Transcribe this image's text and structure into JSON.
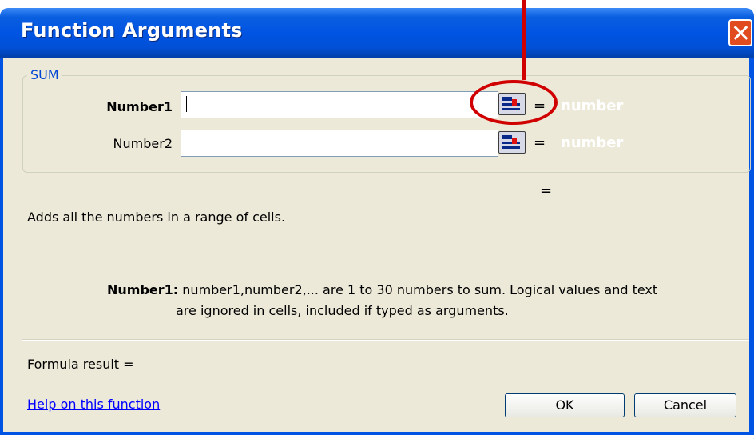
{
  "dialog": {
    "title": "Function Arguments",
    "group_label": "SUM",
    "arguments": [
      {
        "label": "Number1",
        "value": "",
        "equals": "=",
        "hint": "number"
      },
      {
        "label": "Number2",
        "value": "",
        "equals": "=",
        "hint": "number"
      }
    ],
    "result_equals": "=",
    "description": "Adds all the numbers in a range of cells.",
    "arg_help_name": "Number1:",
    "arg_help_line1": "number1,number2,... are 1 to 30 numbers to sum. Logical values and text",
    "arg_help_line2": "are ignored in cells, included if typed as arguments.",
    "formula_result_label": "Formula result =",
    "help_link": "Help on this function",
    "ok_label": "OK",
    "cancel_label": "Cancel"
  },
  "icons": {
    "close": "close-icon",
    "range_selector": "collapse-dialog-icon"
  },
  "colors": {
    "titlebar": "#0054e3",
    "body": "#ece9d8",
    "annotation": "#d00000",
    "link": "#0000ff"
  }
}
